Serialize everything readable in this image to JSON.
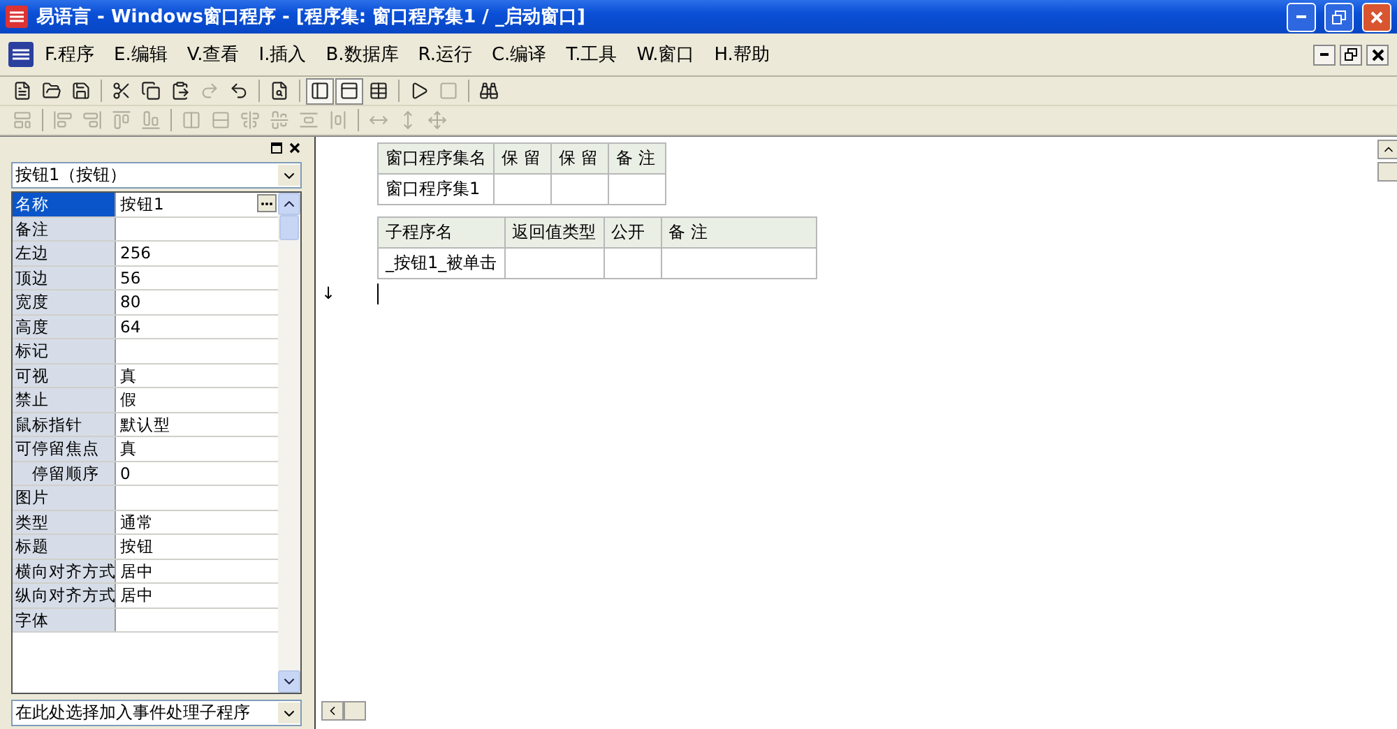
{
  "window": {
    "title": "易语言 - Windows窗口程序 - [程序集: 窗口程序集1 / _启动窗口]"
  },
  "menu": [
    {
      "label": "F.程序"
    },
    {
      "label": "E.编辑"
    },
    {
      "label": "V.查看"
    },
    {
      "label": "I.插入"
    },
    {
      "label": "B.数据库"
    },
    {
      "label": "R.运行"
    },
    {
      "label": "C.编译"
    },
    {
      "label": "T.工具"
    },
    {
      "label": "W.窗口"
    },
    {
      "label": "H.帮助"
    }
  ],
  "toolbar": [
    {
      "disabled": false,
      "pressed": false
    },
    {
      "disabled": false,
      "pressed": false
    },
    {
      "disabled": false,
      "pressed": false
    },
    {
      "disabled": false,
      "pressed": false
    },
    {
      "disabled": false,
      "pressed": false
    },
    {
      "disabled": false,
      "pressed": false
    },
    {
      "disabled": true,
      "pressed": false
    },
    {
      "disabled": false,
      "pressed": false
    },
    {
      "disabled": false,
      "pressed": false
    },
    {
      "disabled": false,
      "pressed": true
    },
    {
      "disabled": false,
      "pressed": true
    },
    {
      "disabled": false,
      "pressed": false
    },
    {
      "disabled": false,
      "pressed": false
    },
    {
      "disabled": true,
      "pressed": false
    },
    {
      "disabled": false,
      "pressed": false
    }
  ],
  "align_toolbar": [
    {
      "disabled": true
    },
    {
      "disabled": true
    },
    {
      "disabled": true
    },
    {
      "disabled": true
    },
    {
      "disabled": true
    },
    {
      "disabled": true
    },
    {
      "disabled": true
    },
    {
      "disabled": true
    },
    {
      "disabled": true
    },
    {
      "disabled": true
    },
    {
      "disabled": true
    },
    {
      "disabled": true
    },
    {
      "disabled": true
    },
    {
      "disabled": true
    }
  ],
  "properties": {
    "object": "按钮1（按钮）",
    "rows": [
      {
        "name": "名称",
        "value": "按钮1",
        "selected": true
      },
      {
        "name": "备注",
        "selected": false
      },
      {
        "name": "左边",
        "value": "256",
        "selected": false
      },
      {
        "name": "顶边",
        "value": "56",
        "selected": false
      },
      {
        "name": "宽度",
        "value": "80",
        "selected": false
      },
      {
        "name": "高度",
        "value": "64",
        "selected": false
      },
      {
        "name": "标记",
        "selected": false
      },
      {
        "name": "可视",
        "value": "真",
        "selected": false
      },
      {
        "name": "禁止",
        "value": "假",
        "selected": false
      },
      {
        "name": "鼠标指针",
        "value": "默认型",
        "selected": false
      },
      {
        "name": "可停留焦点",
        "value": "真",
        "selected": false,
        "children": [
          {
            "name": "停留顺序",
            "value": "0",
            "selected": false
          }
        ]
      },
      {
        "name": "图片",
        "selected": false
      },
      {
        "name": "类型",
        "value": "通常",
        "selected": false
      },
      {
        "name": "标题",
        "value": "按钮",
        "selected": false
      },
      {
        "name": "横向对齐方式",
        "value": "居中",
        "selected": false
      },
      {
        "name": "纵向对齐方式",
        "value": "居中",
        "selected": false
      },
      {
        "name": "字体",
        "selected": false
      }
    ],
    "event": "在此处选择加入事件处理子程序"
  },
  "editor": {
    "tables": [
      {
        "columns": [
          "窗口程序集名",
          "保 留",
          "保 留",
          "备 注"
        ],
        "rows": [
          [
            "窗口程序集1"
          ]
        ]
      },
      {
        "columns": [
          "子程序名",
          "返回值类型",
          "公开",
          "备 注"
        ],
        "rows": [
          [
            "_按钮1_被单击"
          ]
        ]
      }
    ],
    "marker": "↓"
  }
}
